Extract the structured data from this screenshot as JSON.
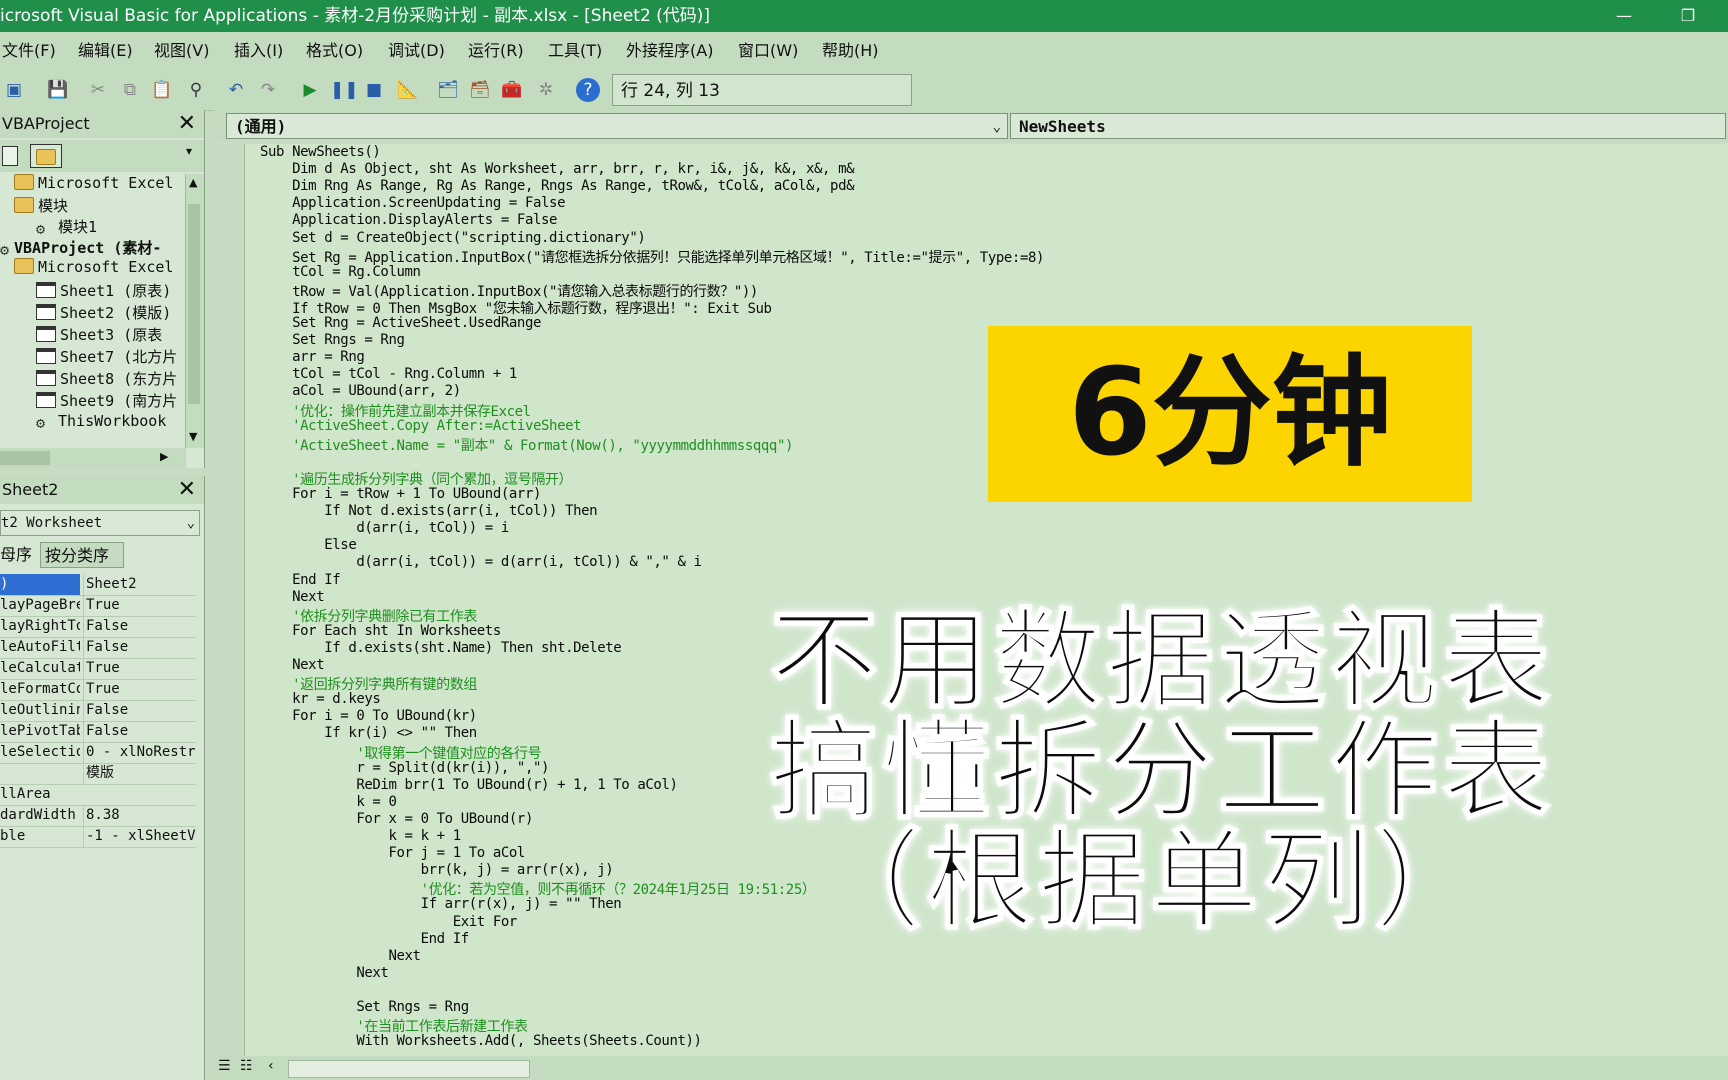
{
  "window": {
    "title": "icrosoft Visual Basic for Applications - 素材-2月份采购计划 - 副本.xlsx - [Sheet2 (代码)]",
    "minimize": "—",
    "restore": "❐"
  },
  "menu": [
    "文件(F)",
    "编辑(E)",
    "视图(V)",
    "插入(I)",
    "格式(O)",
    "调试(D)",
    "运行(R)",
    "工具(T)",
    "外接程序(A)",
    "窗口(W)",
    "帮助(H)"
  ],
  "toolbar": {
    "cursor_position": "行 24, 列 13"
  },
  "project_pane": {
    "title": "VBAProject",
    "close": "✕",
    "tree": [
      "Microsoft Excel",
      "模块",
      "模块1",
      "VBAProject (素材-",
      "Microsoft Excel",
      "Sheet1 (原表)",
      "Sheet2 (模版)",
      "Sheet3 (原表",
      "Sheet7 (北方片",
      "Sheet8 (东方片",
      "Sheet9 (南方片",
      "ThisWorkbook"
    ]
  },
  "props_pane": {
    "title": "Sheet2",
    "close": "✕",
    "object_combo": "t2 Worksheet",
    "tabs": [
      "母序",
      "按分类序"
    ],
    "rows": [
      {
        "k": ")",
        "v": "Sheet2"
      },
      {
        "k": "layPageBre",
        "v": "True"
      },
      {
        "k": "layRightTo",
        "v": "False"
      },
      {
        "k": "leAutoFilt",
        "v": "False"
      },
      {
        "k": "leCalculat",
        "v": "True"
      },
      {
        "k": "leFormatCo",
        "v": "True"
      },
      {
        "k": "leOutlinin",
        "v": "False"
      },
      {
        "k": "lePivotTab",
        "v": "False"
      },
      {
        "k": "leSelectio",
        "v": "0 - xlNoRestr"
      },
      {
        "k": "",
        "v": "模版"
      },
      {
        "k": "llArea",
        "v": ""
      },
      {
        "k": "dardWidth",
        "v": "8.38"
      },
      {
        "k": "ble",
        "v": "-1 - xlSheetV"
      }
    ]
  },
  "code_header": {
    "object": "(通用)",
    "procedure": "NewSheets"
  },
  "code_lines": [
    "Sub NewSheets()",
    "    Dim d As Object, sht As Worksheet, arr, brr, r, kr, i&, j&, k&, x&, m&",
    "    Dim Rng As Range, Rg As Range, Rngs As Range, tRow&, tCol&, aCol&, pd&",
    "    Application.ScreenUpdating = False",
    "    Application.DisplayAlerts = False",
    "    Set d = CreateObject(\"scripting.dictionary\")",
    "    Set Rg = Application.InputBox(\"请您框选拆分依据列！只能选择单列单元格区域！\", Title:=\"提示\", Type:=8)",
    "    tCol = Rg.Column",
    "    tRow = Val(Application.InputBox(\"请您输入总表标题行的行数？\"))",
    "    If tRow = 0 Then MsgBox \"您未输入标题行数，程序退出！\": Exit Sub",
    "    Set Rng = ActiveSheet.UsedRange",
    "    Set Rngs = Rng",
    "    arr = Rng",
    "    tCol = tCol - Rng.Column + 1",
    "    aCol = UBound(arr, 2)",
    "    '优化：操作前先建立副本并保存Excel",
    "    'ActiveSheet.Copy After:=ActiveSheet",
    "    'ActiveSheet.Name = \"副本\" & Format(Now(), \"yyyymmddhhmmssqqq\")",
    "",
    "    '遍历生成拆分列字典（同个累加，逗号隔开）",
    "    For i = tRow + 1 To UBound(arr)",
    "        If Not d.exists(arr(i, tCol)) Then",
    "            d(arr(i, tCol)) = i",
    "        Else",
    "            d(arr(i, tCol)) = d(arr(i, tCol)) & \",\" & i",
    "    End If",
    "    Next",
    "    '依拆分列字典删除已有工作表",
    "    For Each sht In Worksheets",
    "        If d.exists(sht.Name) Then sht.Delete",
    "    Next",
    "    '返回拆分列字典所有键的数组",
    "    kr = d.keys",
    "    For i = 0 To UBound(kr)",
    "        If kr(i) <> \"\" Then",
    "            '取得第一个键值对应的各行号",
    "            r = Split(d(kr(i)), \",\")",
    "            ReDim brr(1 To UBound(r) + 1, 1 To aCol)",
    "            k = 0",
    "            For x = 0 To UBound(r)",
    "                k = k + 1",
    "                For j = 1 To aCol",
    "                    brr(k, j) = arr(r(x), j)",
    "                    '优化：若为空值，则不再循环（？2024年1月25日 19:51:25）",
    "                    If arr(r(x), j) = \"\" Then",
    "                        Exit For",
    "                    End If",
    "                Next",
    "            Next",
    "",
    "            Set Rngs = Rng",
    "            '在当前工作表后新建工作表",
    "            With Worksheets.Add(, Sheets(Sheets.Count))"
  ],
  "overlay": {
    "badge": "6分钟",
    "line1": "不用数据透视表",
    "line2": "搞懂拆分工作表",
    "line3": "（根据单列）"
  },
  "colors": {
    "title_bar": "#1f8f4a",
    "chrome": "#c3dcbf",
    "code_bg": "#cfe6cb",
    "keyword": "#1a3aa8",
    "comment": "#1f8f1f",
    "badge": "#fcd400"
  }
}
